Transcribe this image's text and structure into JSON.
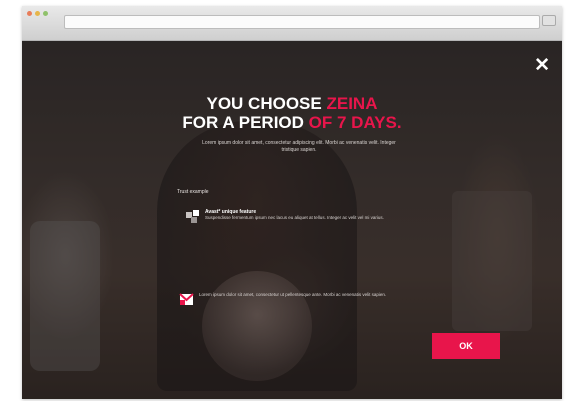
{
  "modal": {
    "close_label": "✕",
    "headline_line1_prefix": "YOU CHOOSE",
    "headline_line1_accent": "ZEINA",
    "headline_line2_prefix": "FOR A PERIOD",
    "headline_line2_accent": "OF 7 DAYS.",
    "subtext": "Lorem ipsum dolor sit amet, consectetur adipiscing elit. Morbi ac venenatis velit. Integer tristique sapien.",
    "features_title": "Trust example",
    "feature1": {
      "title": "Avast* unique",
      "title_accent": "feature",
      "text": "Suspendisse fermentum ipsum nec lacus eu aliquet at tellus. Integer ac velit vel mi varius."
    },
    "feature2": {
      "text": "Lorem ipsum dolor sit amet, consectetur ut pellentesque ante. Morbi ac venenatis velit sapien."
    },
    "ok_label": "OK"
  },
  "colors": {
    "accent": "#e8154b",
    "overlay": "#2b2726"
  }
}
